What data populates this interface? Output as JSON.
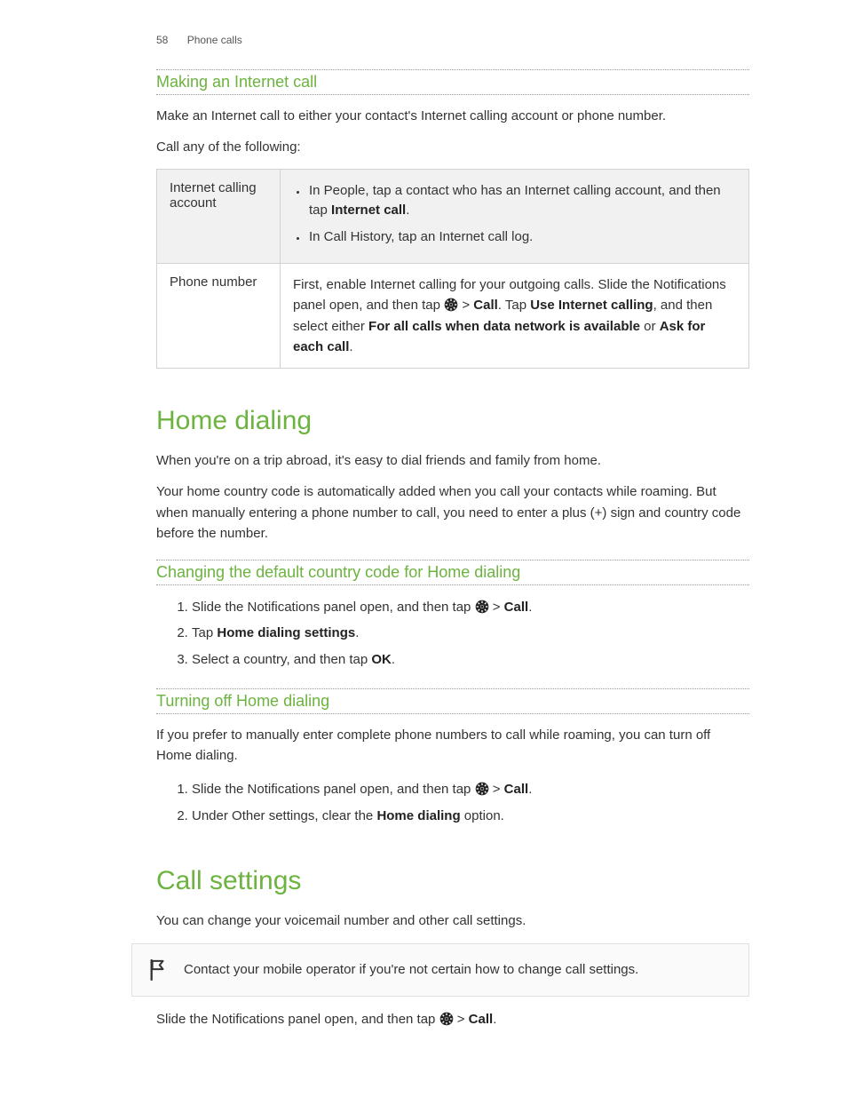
{
  "header": {
    "page_number": "58",
    "section": "Phone calls"
  },
  "sec1": {
    "title": "Making an Internet call",
    "intro": "Make an Internet call to either your contact's Internet calling account or phone number.",
    "call_prompt": "Call any of the following:",
    "table": {
      "row1_label": "Internet calling account",
      "row1_b1a": "In People, tap a contact who has an Internet calling account, and then tap ",
      "row1_b1b": "Internet call",
      "row1_b1c": ".",
      "row1_b2": "In Call History, tap an Internet call log.",
      "row2_label": "Phone number",
      "row2_a": "First, enable Internet calling for your outgoing calls. Slide the Notifications panel open, and then tap ",
      "row2_b": " > ",
      "row2_c": "Call",
      "row2_d": ". Tap ",
      "row2_e": "Use Internet calling",
      "row2_f": ", and then select either ",
      "row2_g": "For all calls when data network is available",
      "row2_h": " or ",
      "row2_i": "Ask for each call",
      "row2_j": "."
    }
  },
  "sec2": {
    "title": "Home dialing",
    "p1": "When you're on a trip abroad, it's easy to dial friends and family from home.",
    "p2": "Your home country code is automatically added when you call your contacts while roaming. But when manually entering a phone number to call, you need to enter a plus (+) sign and country code before the number.",
    "sub1": {
      "title": "Changing the default country code for Home dialing",
      "s1a": "Slide the Notifications panel open, and then tap ",
      "s1b": " > ",
      "s1c": "Call",
      "s1d": ".",
      "s2a": "Tap ",
      "s2b": "Home dialing settings",
      "s2c": ".",
      "s3a": "Select a country, and then tap ",
      "s3b": "OK",
      "s3c": "."
    },
    "sub2": {
      "title": "Turning off Home dialing",
      "p": "If you prefer to manually enter complete phone numbers to call while roaming, you can turn off Home dialing.",
      "s1a": "Slide the Notifications panel open, and then tap ",
      "s1b": " > ",
      "s1c": "Call",
      "s1d": ".",
      "s2a": "Under Other settings, clear the ",
      "s2b": "Home dialing",
      "s2c": " option."
    }
  },
  "sec3": {
    "title": "Call settings",
    "p1": "You can change your voicemail number and other call settings.",
    "note": "Contact your mobile operator if you're not certain how to change call settings.",
    "p2a": "Slide the Notifications panel open, and then tap ",
    "p2b": " > ",
    "p2c": "Call",
    "p2d": "."
  }
}
